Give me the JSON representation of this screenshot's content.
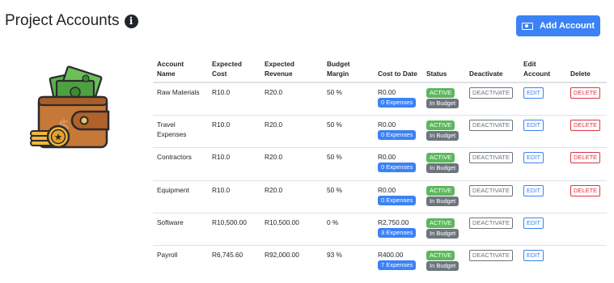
{
  "page": {
    "title": "Project Accounts",
    "add_button_label": "Add Account"
  },
  "table": {
    "headers": {
      "account_name": "Account Name",
      "expected_cost": "Expected Cost",
      "expected_revenue": "Expected Revenue",
      "budget_margin": "Budget Margin",
      "cost_to_date": "Cost to Date",
      "status": "Status",
      "deactivate": "Deactivate",
      "edit_account": "Edit Account",
      "delete": "Delete"
    },
    "rows": [
      {
        "name": "Raw Materials",
        "expected_cost": "R10.0",
        "expected_revenue": "R20.0",
        "budget_margin": "50 %",
        "cost_to_date": "R0.00",
        "expenses": "0 Expenses",
        "status": "ACTIVE",
        "budget_status": "In Budget",
        "deactivate": "DEACTIVATE",
        "edit": "EDIT",
        "delete": "DELETE"
      },
      {
        "name": "Travel Expenses",
        "expected_cost": "R10.0",
        "expected_revenue": "R20.0",
        "budget_margin": "50 %",
        "cost_to_date": "R0.00",
        "expenses": "0 Expenses",
        "status": "ACTIVE",
        "budget_status": "In Budget",
        "deactivate": "DEACTIVATE",
        "edit": "EDIT",
        "delete": "DELETE"
      },
      {
        "name": "Contractors",
        "expected_cost": "R10.0",
        "expected_revenue": "R20.0",
        "budget_margin": "50 %",
        "cost_to_date": "R0.00",
        "expenses": "0 Expenses",
        "status": "ACTIVE",
        "budget_status": "In Budget",
        "deactivate": "DEACTIVATE",
        "edit": "EDIT",
        "delete": "DELETE"
      },
      {
        "name": "Equipment",
        "expected_cost": "R10.0",
        "expected_revenue": "R20.0",
        "budget_margin": "50 %",
        "cost_to_date": "R0.00",
        "expenses": "0 Expenses",
        "status": "ACTIVE",
        "budget_status": "In Budget",
        "deactivate": "DEACTIVATE",
        "edit": "EDIT",
        "delete": "DELETE"
      },
      {
        "name": "Software",
        "expected_cost": "R10,500.00",
        "expected_revenue": "R10,500.00",
        "budget_margin": "0 %",
        "cost_to_date": "R2,750.00",
        "expenses": "3 Expenses",
        "status": "ACTIVE",
        "budget_status": "In Budget",
        "deactivate": "DEACTIVATE",
        "edit": "EDIT",
        "delete": ""
      },
      {
        "name": "Payroll",
        "expected_cost": "R6,745.60",
        "expected_revenue": "R92,000.00",
        "budget_margin": "93 %",
        "cost_to_date": "R400.00",
        "expenses": "7 Expenses",
        "status": "ACTIVE",
        "budget_status": "In Budget",
        "deactivate": "DEACTIVATE",
        "edit": "EDIT",
        "delete": ""
      }
    ]
  },
  "icons": {
    "title_icon": "info-icon",
    "add_button_icon": "money-icon",
    "illustration": "wallet-icon"
  },
  "colors": {
    "primary": "#3b82f6",
    "active": "#5cb85c",
    "in_budget": "#6c757d",
    "delete": "#dc3545"
  }
}
